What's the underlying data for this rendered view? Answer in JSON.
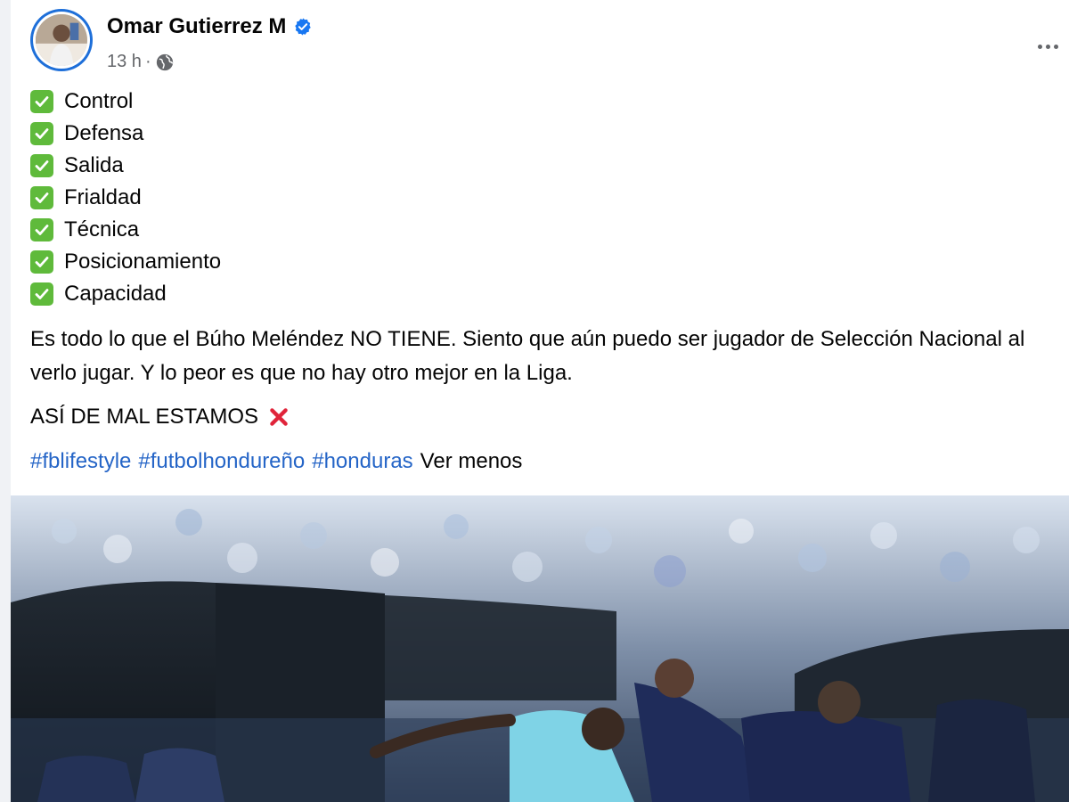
{
  "post": {
    "author": "Omar Gutierrez M",
    "time": "13 h",
    "separator": "·",
    "checklist": [
      "Control",
      "Defensa",
      "Salida",
      "Frialdad",
      "Técnica",
      "Posicionamiento",
      "Capacidad"
    ],
    "paragraph": "Es todo lo que el Búho Meléndez NO TIENE. Siento que aún puedo ser jugador de Selección Nacional al verlo jugar. Y lo peor es que no hay otro mejor en la Liga.",
    "shout": "ASÍ DE MAL ESTAMOS",
    "hashtags": [
      "#fblifestyle",
      "#futbolhondureño",
      "#honduras"
    ],
    "see_less": "Ver menos"
  },
  "icons": {
    "verified": "verified-badge-icon",
    "privacy": "globe-icon",
    "more": "more-options-icon",
    "check": "check-mark-icon",
    "cross": "cross-mark-icon"
  },
  "colors": {
    "verified": "#1877f2",
    "hashtag": "#2565c7",
    "check": "#5fba3b",
    "cross": "#e0243a",
    "muted": "#65676b"
  }
}
